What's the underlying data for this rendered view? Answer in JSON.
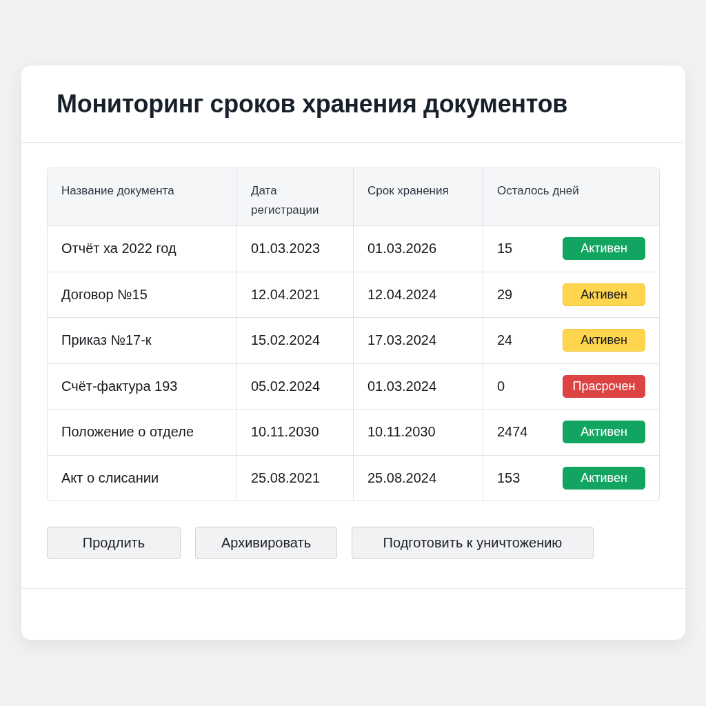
{
  "title": "Мониторинг сроков хранения документов",
  "table": {
    "columns": [
      "Название документа",
      "Дата регистрации",
      "Срок хранения",
      "Осталось дней"
    ],
    "rows": [
      {
        "name": "Отчёт ха 2022 год",
        "registered": "01.03.2023",
        "retention": "01.03.2026",
        "days_left": "15",
        "status": {
          "label": "Активен",
          "color": "#12a562"
        }
      },
      {
        "name": "Договор №15",
        "registered": "12.04.2021",
        "retention": "12.04.2024",
        "days_left": "29",
        "status": {
          "label": "Активен",
          "color": "#fdd54f"
        }
      },
      {
        "name": "Приказ №17-к",
        "registered": "15.02.2024",
        "retention": "17.03.2024",
        "days_left": "24",
        "status": {
          "label": "Активен",
          "color": "#fdd54f"
        }
      },
      {
        "name": "Счёт-фактура 193",
        "registered": "05.02.2024",
        "retention": "01.03.2024",
        "days_left": "0",
        "status": {
          "label": "Прасрочен",
          "color": "#dc4343"
        }
      },
      {
        "name": "Положение о отделе",
        "registered": "10.11.2030",
        "retention": "10.11.2030",
        "days_left": "2474",
        "status": {
          "label": "Активен",
          "color": "#12a562"
        }
      },
      {
        "name": "Акт о слисании",
        "registered": "25.08.2021",
        "retention": "25.08.2024",
        "days_left": "153",
        "status": {
          "label": "Активен",
          "color": "#12a562"
        }
      }
    ]
  },
  "buttons": [
    "Продлить",
    "Архивировать",
    "Подготовить к уничтожению"
  ]
}
